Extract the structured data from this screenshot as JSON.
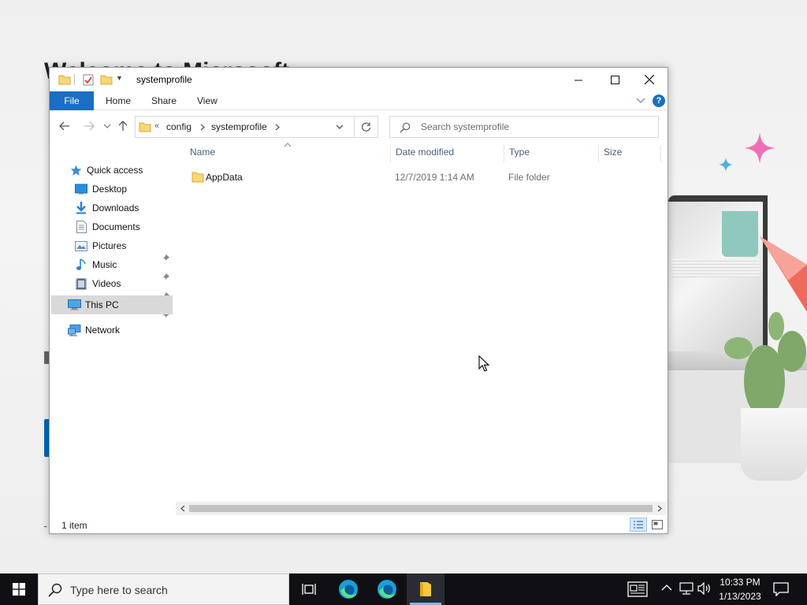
{
  "desktop": {
    "heading_fragment": "Welcome to Microsoft",
    "colors": {
      "accent": "#0067b8"
    }
  },
  "window": {
    "title": "systemprofile",
    "icons": {
      "quick_access_toolbar": [
        "folder-icon",
        "properties-icon",
        "new-folder-icon",
        "dropdown-icon"
      ],
      "caption": [
        "minimize-icon",
        "maximize-icon",
        "close-icon"
      ]
    }
  },
  "ribbon": {
    "tabs": [
      "File",
      "Home",
      "Share",
      "View"
    ],
    "help_label": "?",
    "colors": {
      "file_tab": "#1a6fc2"
    }
  },
  "address": {
    "overflow": "«",
    "crumbs": [
      "config",
      "systemprofile"
    ],
    "search_placeholder": "Search systemprofile"
  },
  "nav_pane": {
    "quick_access": "Quick access",
    "pinned": [
      {
        "label": "Desktop",
        "icon": "desktop-icon",
        "pinned": true
      },
      {
        "label": "Downloads",
        "icon": "downloads-icon",
        "pinned": true
      },
      {
        "label": "Documents",
        "icon": "documents-icon",
        "pinned": true
      },
      {
        "label": "Pictures",
        "icon": "pictures-icon",
        "pinned": true
      },
      {
        "label": "Music",
        "icon": "music-icon",
        "pinned": false
      },
      {
        "label": "Videos",
        "icon": "videos-icon",
        "pinned": false
      }
    ],
    "this_pc": "This PC",
    "network": "Network",
    "selected": "This PC"
  },
  "files": {
    "columns": [
      "Name",
      "Date modified",
      "Type",
      "Size"
    ],
    "rows": [
      {
        "name": "AppData",
        "date_modified": "12/7/2019 1:14 AM",
        "type": "File folder",
        "size": ""
      }
    ]
  },
  "status": {
    "item_count": "1 item"
  },
  "taskbar": {
    "search_placeholder": "Type here to search",
    "apps": [
      "task-view-icon",
      "edge-icon",
      "edge-icon",
      "file-explorer-icon"
    ],
    "active_app": "file-explorer-icon",
    "time": "10:33 PM",
    "date": "1/13/2023"
  }
}
